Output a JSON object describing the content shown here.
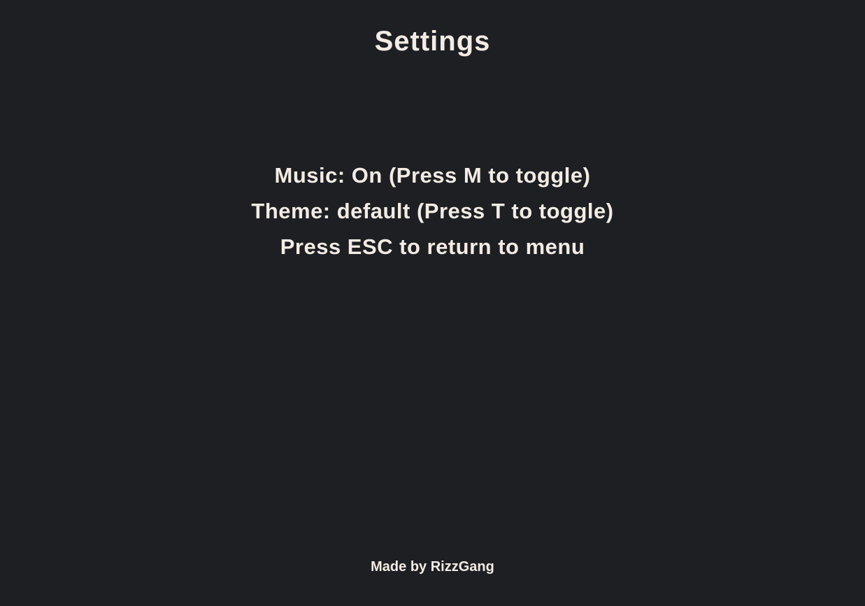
{
  "screen": {
    "title": "Settings",
    "options": [
      "Music: On (Press M to toggle)",
      "Theme: default (Press T to toggle)",
      "Press ESC to return to menu"
    ],
    "footer": "Made by RizzGang"
  },
  "colors": {
    "background": "#1d1f23",
    "text": "#f3ece4"
  }
}
